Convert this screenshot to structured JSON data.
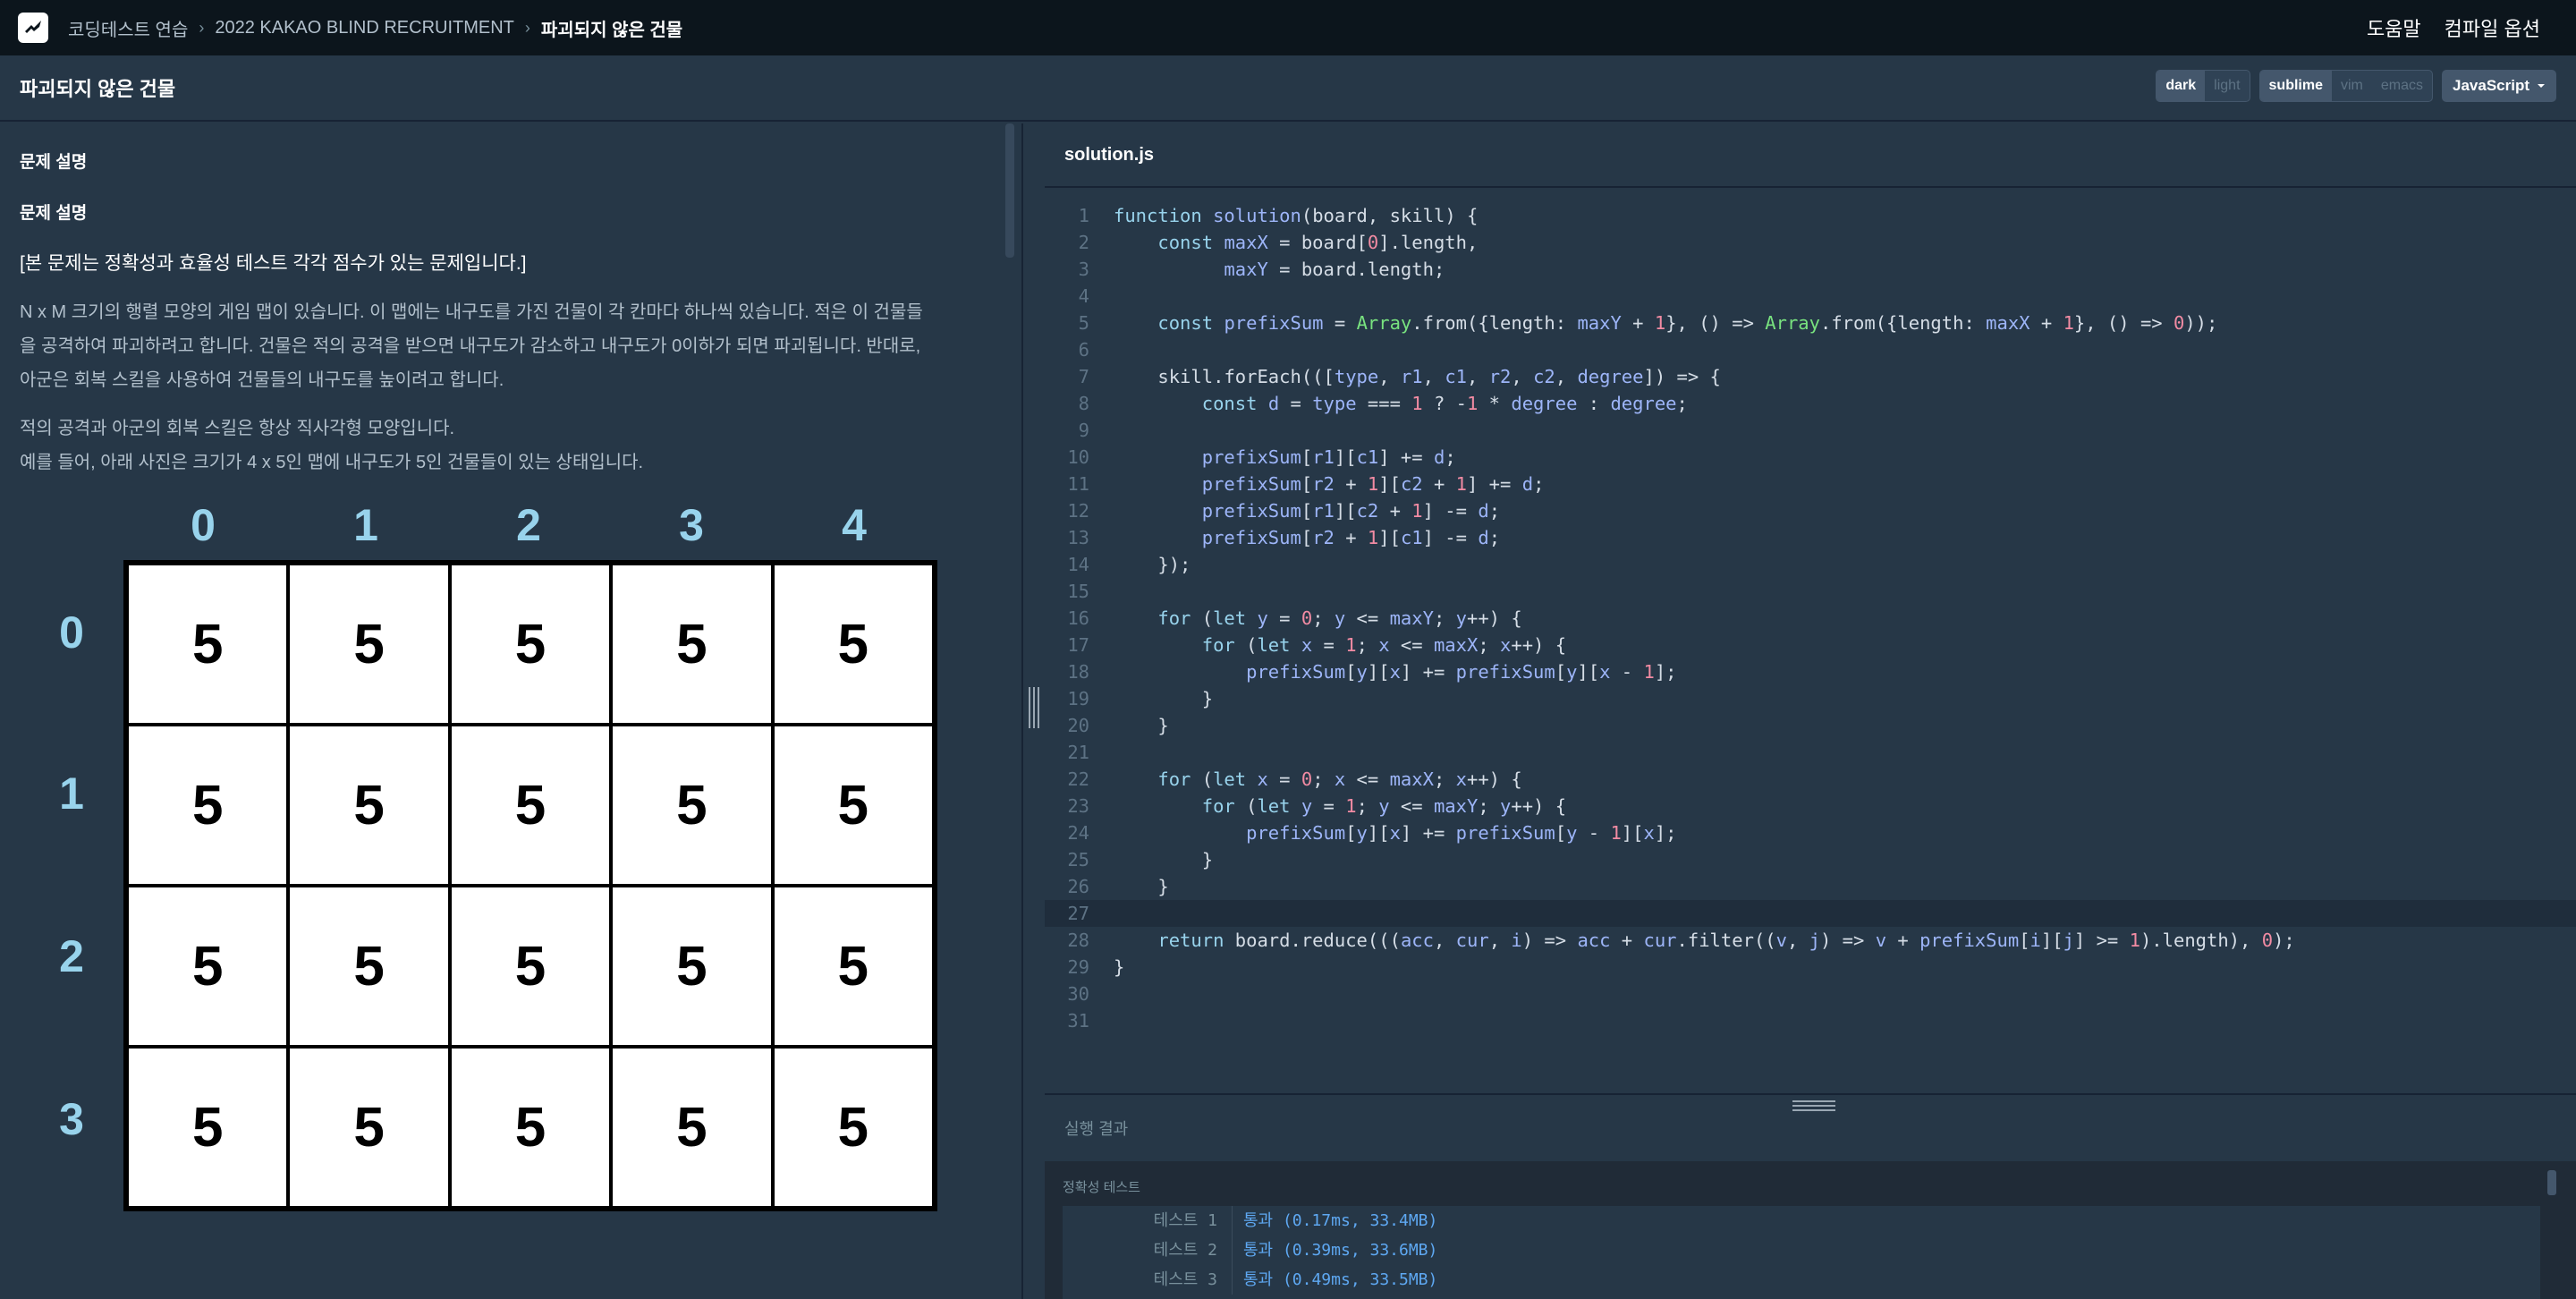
{
  "nav": {
    "breadcrumbs": [
      "코딩테스트 연습",
      "2022 KAKAO BLIND RECRUITMENT",
      "파괴되지 않은 건물"
    ],
    "help": "도움말",
    "compile_options": "컴파일 옵션"
  },
  "title": "파괴되지 않은 건물",
  "toolbar": {
    "themes": [
      "dark",
      "light"
    ],
    "active_theme": "dark",
    "keymaps": [
      "sublime",
      "vim",
      "emacs"
    ],
    "active_keymap": "sublime",
    "language": "JavaScript"
  },
  "description": {
    "heading1": "문제 설명",
    "heading2": "문제 설명",
    "notice": "[본 문제는 정확성과 효율성 테스트 각각 점수가 있는 문제입니다.]",
    "para1_lines": [
      "N x M 크기의 행렬 모양의 게임 맵이 있습니다. 이 맵에는 내구도를 가진 건물이 각 칸마다 하나씩 있습니다. 적은 이 건물들",
      "을 공격하여 파괴하려고 합니다. 건물은 적의 공격을 받으면 내구도가 감소하고 내구도가 0이하가 되면 파괴됩니다. 반대로,",
      "아군은 회복 스킬을 사용하여 건물들의 내구도를 높이려고 합니다."
    ],
    "para2_lines": [
      "적의 공격과 아군의 회복 스킬은 항상 직사각형 모양입니다.",
      "예를 들어, 아래 사진은 크기가 4 x 5인 맵에 내구도가 5인 건물들이 있는 상태입니다."
    ]
  },
  "figure": {
    "col_labels": [
      "0",
      "1",
      "2",
      "3",
      "4"
    ],
    "row_labels": [
      "0",
      "1",
      "2",
      "3"
    ],
    "cells": [
      [
        "5",
        "5",
        "5",
        "5",
        "5"
      ],
      [
        "5",
        "5",
        "5",
        "5",
        "5"
      ],
      [
        "5",
        "5",
        "5",
        "5",
        "5"
      ],
      [
        "5",
        "5",
        "5",
        "5",
        "5"
      ]
    ]
  },
  "editor": {
    "file_name": "solution.js",
    "highlighted_line": 27,
    "lines": [
      "function solution(board, skill) {",
      "    const maxX = board[0].length,",
      "          maxY = board.length;",
      "",
      "    const prefixSum = Array.from({length: maxY + 1}, () => Array.from({length: maxX + 1}, () => 0));",
      "",
      "    skill.forEach(([type, r1, c1, r2, c2, degree]) => {",
      "        const d = type === 1 ? -1 * degree : degree;",
      "",
      "        prefixSum[r1][c1] += d;",
      "        prefixSum[r2 + 1][c2 + 1] += d;",
      "        prefixSum[r1][c2 + 1] -= d;",
      "        prefixSum[r2 + 1][c1] -= d;",
      "    });",
      "",
      "    for (let y = 0; y <= maxY; y++) {",
      "        for (let x = 1; x <= maxX; x++) {",
      "            prefixSum[y][x] += prefixSum[y][x - 1];",
      "        }",
      "    }",
      "",
      "    for (let x = 0; x <= maxX; x++) {",
      "        for (let y = 1; y <= maxY; y++) {",
      "            prefixSum[y][x] += prefixSum[y - 1][x];",
      "        }",
      "    }",
      "",
      "    return board.reduce(((acc, cur, i) => acc + cur.filter((v, j) => v + prefixSum[i][j] >= 1).length), 0);",
      "}",
      "",
      ""
    ]
  },
  "results": {
    "title": "실행 결과",
    "tab_label": "정확성  테스트",
    "rows": [
      {
        "name": "테스트 1",
        "value": "통과 (0.17ms, 33.4MB)"
      },
      {
        "name": "테스트 2",
        "value": "통과 (0.39ms, 33.6MB)"
      },
      {
        "name": "테스트 3",
        "value": "통과 (0.49ms, 33.5MB)"
      }
    ]
  }
}
